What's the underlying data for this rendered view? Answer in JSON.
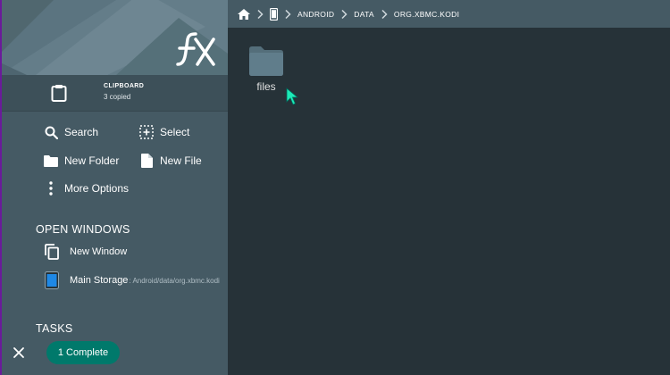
{
  "clipboard": {
    "title": "CLIPBOARD",
    "subtitle": "3 copied"
  },
  "actions": {
    "search": "Search",
    "select": "Select",
    "new_folder": "New Folder",
    "new_file": "New File",
    "more_options": "More Options"
  },
  "open_windows": {
    "title": "OPEN WINDOWS",
    "new_window": "New Window",
    "main_storage": {
      "label": "Main Storage",
      "path": ": Android/data/org.xbmc.kodi"
    }
  },
  "tasks": {
    "title": "TASKS",
    "complete_label": "1 Complete"
  },
  "breadcrumb": [
    "ANDROID",
    "DATA",
    "ORG.XBMC.KODI"
  ],
  "files": [
    {
      "name": "files",
      "icon": "folder-icon"
    }
  ],
  "colors": {
    "drawer": "#455a64",
    "drawer_header": "#546e7a",
    "content_bg": "#263238",
    "accent_chip": "#00796b",
    "cursor": "#1de9b6"
  }
}
